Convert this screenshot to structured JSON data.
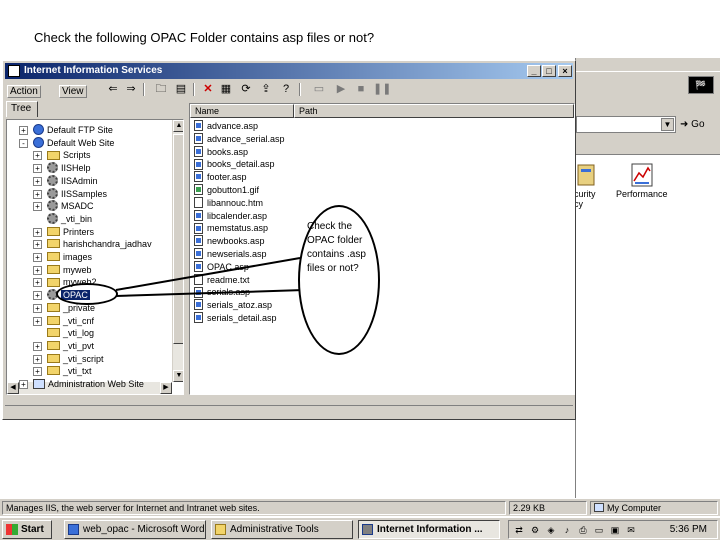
{
  "caption": "Check the following OPAC Folder contains asp files or not?",
  "background_window": {
    "logo": "🏁",
    "go_label": "Go",
    "icons": [
      {
        "label": "Local Security\nPolicy",
        "display": "curity\ncy"
      },
      {
        "label": "Performance",
        "display": "Performance"
      }
    ]
  },
  "window": {
    "title": "Internet Information Services",
    "controls": {
      "minimize": "_",
      "maximize": "□",
      "close": "×"
    },
    "menu": {
      "action": "Action",
      "view": "View"
    },
    "tree_tab": "Tree",
    "tree": [
      {
        "label": "Default FTP Site",
        "icon": "globe",
        "level": 1,
        "pm": "+"
      },
      {
        "label": "Default Web Site",
        "icon": "globe",
        "level": 1,
        "pm": "-"
      },
      {
        "label": "Scripts",
        "icon": "folder",
        "level": 2,
        "pm": "+"
      },
      {
        "label": "IISHelp",
        "icon": "gear",
        "level": 2,
        "pm": "+"
      },
      {
        "label": "IISAdmin",
        "icon": "gear",
        "level": 2,
        "pm": "+"
      },
      {
        "label": "IISSamples",
        "icon": "gear",
        "level": 2,
        "pm": "+"
      },
      {
        "label": "MSADC",
        "icon": "gear",
        "level": 2,
        "pm": "+"
      },
      {
        "label": "_vti_bin",
        "icon": "gear",
        "level": 2,
        "pm": ""
      },
      {
        "label": "Printers",
        "icon": "folder",
        "level": 2,
        "pm": "+"
      },
      {
        "label": "harishchandra_jadhav",
        "icon": "folder",
        "level": 2,
        "pm": "+"
      },
      {
        "label": "images",
        "icon": "folder",
        "level": 2,
        "pm": "+"
      },
      {
        "label": "myweb",
        "icon": "folder",
        "level": 2,
        "pm": "+"
      },
      {
        "label": "myweb2",
        "icon": "folder",
        "level": 2,
        "pm": "+"
      },
      {
        "label": "OPAC",
        "icon": "gear",
        "level": 2,
        "pm": "+",
        "selected": true
      },
      {
        "label": "_private",
        "icon": "folder",
        "level": 2,
        "pm": "+"
      },
      {
        "label": "_vti_cnf",
        "icon": "folder",
        "level": 2,
        "pm": "+"
      },
      {
        "label": "_vti_log",
        "icon": "folder",
        "level": 2,
        "pm": ""
      },
      {
        "label": "_vti_pvt",
        "icon": "folder",
        "level": 2,
        "pm": "+"
      },
      {
        "label": "_vti_script",
        "icon": "folder",
        "level": 2,
        "pm": "+"
      },
      {
        "label": "_vti_txt",
        "icon": "folder",
        "level": 2,
        "pm": "+"
      },
      {
        "label": "Administration Web Site",
        "icon": "pc",
        "level": 1,
        "pm": "+"
      }
    ],
    "columns": {
      "name": "Name",
      "path": "Path"
    },
    "files": [
      {
        "name": "advance.asp",
        "type": "asp"
      },
      {
        "name": "advance_serial.asp",
        "type": "asp"
      },
      {
        "name": "books.asp",
        "type": "asp"
      },
      {
        "name": "books_detail.asp",
        "type": "asp"
      },
      {
        "name": "footer.asp",
        "type": "asp"
      },
      {
        "name": "gobutton1.gif",
        "type": "img"
      },
      {
        "name": "libannouc.htm",
        "type": "doc"
      },
      {
        "name": "libcalender.asp",
        "type": "asp"
      },
      {
        "name": "memstatus.asp",
        "type": "asp"
      },
      {
        "name": "newbooks.asp",
        "type": "asp"
      },
      {
        "name": "newserials.asp",
        "type": "asp"
      },
      {
        "name": "OPAC.asp",
        "type": "asp"
      },
      {
        "name": "readme.txt",
        "type": "doc"
      },
      {
        "name": "serials.asp",
        "type": "asp"
      },
      {
        "name": "serials_atoz.asp",
        "type": "asp"
      },
      {
        "name": "serials_detail.asp",
        "type": "asp"
      }
    ]
  },
  "callout": "Check the OPAC folder contains .asp files or not?",
  "status_bar": {
    "message": "Manages IIS, the web server for Internet and Intranet web sites.",
    "size": "2.29 KB",
    "zone": "My Computer"
  },
  "taskbar": {
    "start": "Start",
    "tasks": [
      {
        "label": "web_opac - Microsoft Word",
        "active": false
      },
      {
        "label": "Administrative Tools",
        "active": false
      },
      {
        "label": "Internet Information ...",
        "active": true
      }
    ],
    "clock": "5:36 PM"
  }
}
